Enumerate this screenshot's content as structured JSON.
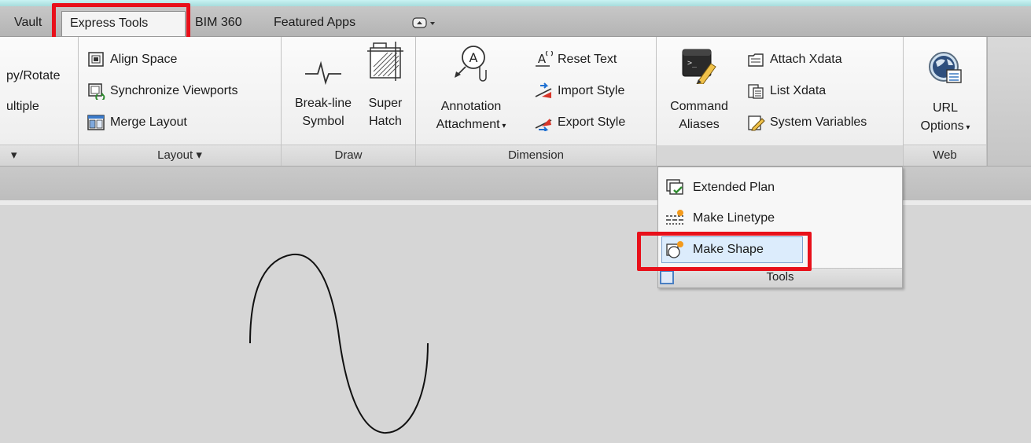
{
  "tabs": [
    {
      "label": "Vault"
    },
    {
      "label": "Express Tools",
      "active": true
    },
    {
      "label": "BIM 360"
    },
    {
      "label": "Featured Apps"
    }
  ],
  "panels": {
    "partial": {
      "items": [
        "py/Rotate",
        "ultiple"
      ],
      "title_caret": "▾"
    },
    "layout": {
      "items": [
        "Align Space",
        "Synchronize Viewports",
        "Merge Layout"
      ],
      "title": "Layout ▾"
    },
    "draw": {
      "breakline": [
        "Break-line",
        "Symbol"
      ],
      "superhatch": [
        "Super",
        "Hatch"
      ],
      "title": "Draw"
    },
    "dimension": {
      "annotation": [
        "Annotation",
        "Attachment"
      ],
      "items": [
        "Reset Text",
        "Import Style",
        "Export Style"
      ],
      "title": "Dimension"
    },
    "tools": {
      "command": [
        "Command",
        "Aliases"
      ],
      "items": [
        "Attach Xdata",
        "List Xdata",
        "System Variables"
      ]
    },
    "web": {
      "url": [
        "URL",
        "Options"
      ],
      "title": "Web"
    }
  },
  "dropdown": {
    "items": [
      "Extended Plan",
      "Make Linetype",
      "Make Shape"
    ],
    "selected": "Make Shape",
    "footer": "Tools"
  },
  "colors": {
    "highlight": "#e8101a",
    "ribbon": "#f4f4f4",
    "selection": "#dcecfc"
  }
}
